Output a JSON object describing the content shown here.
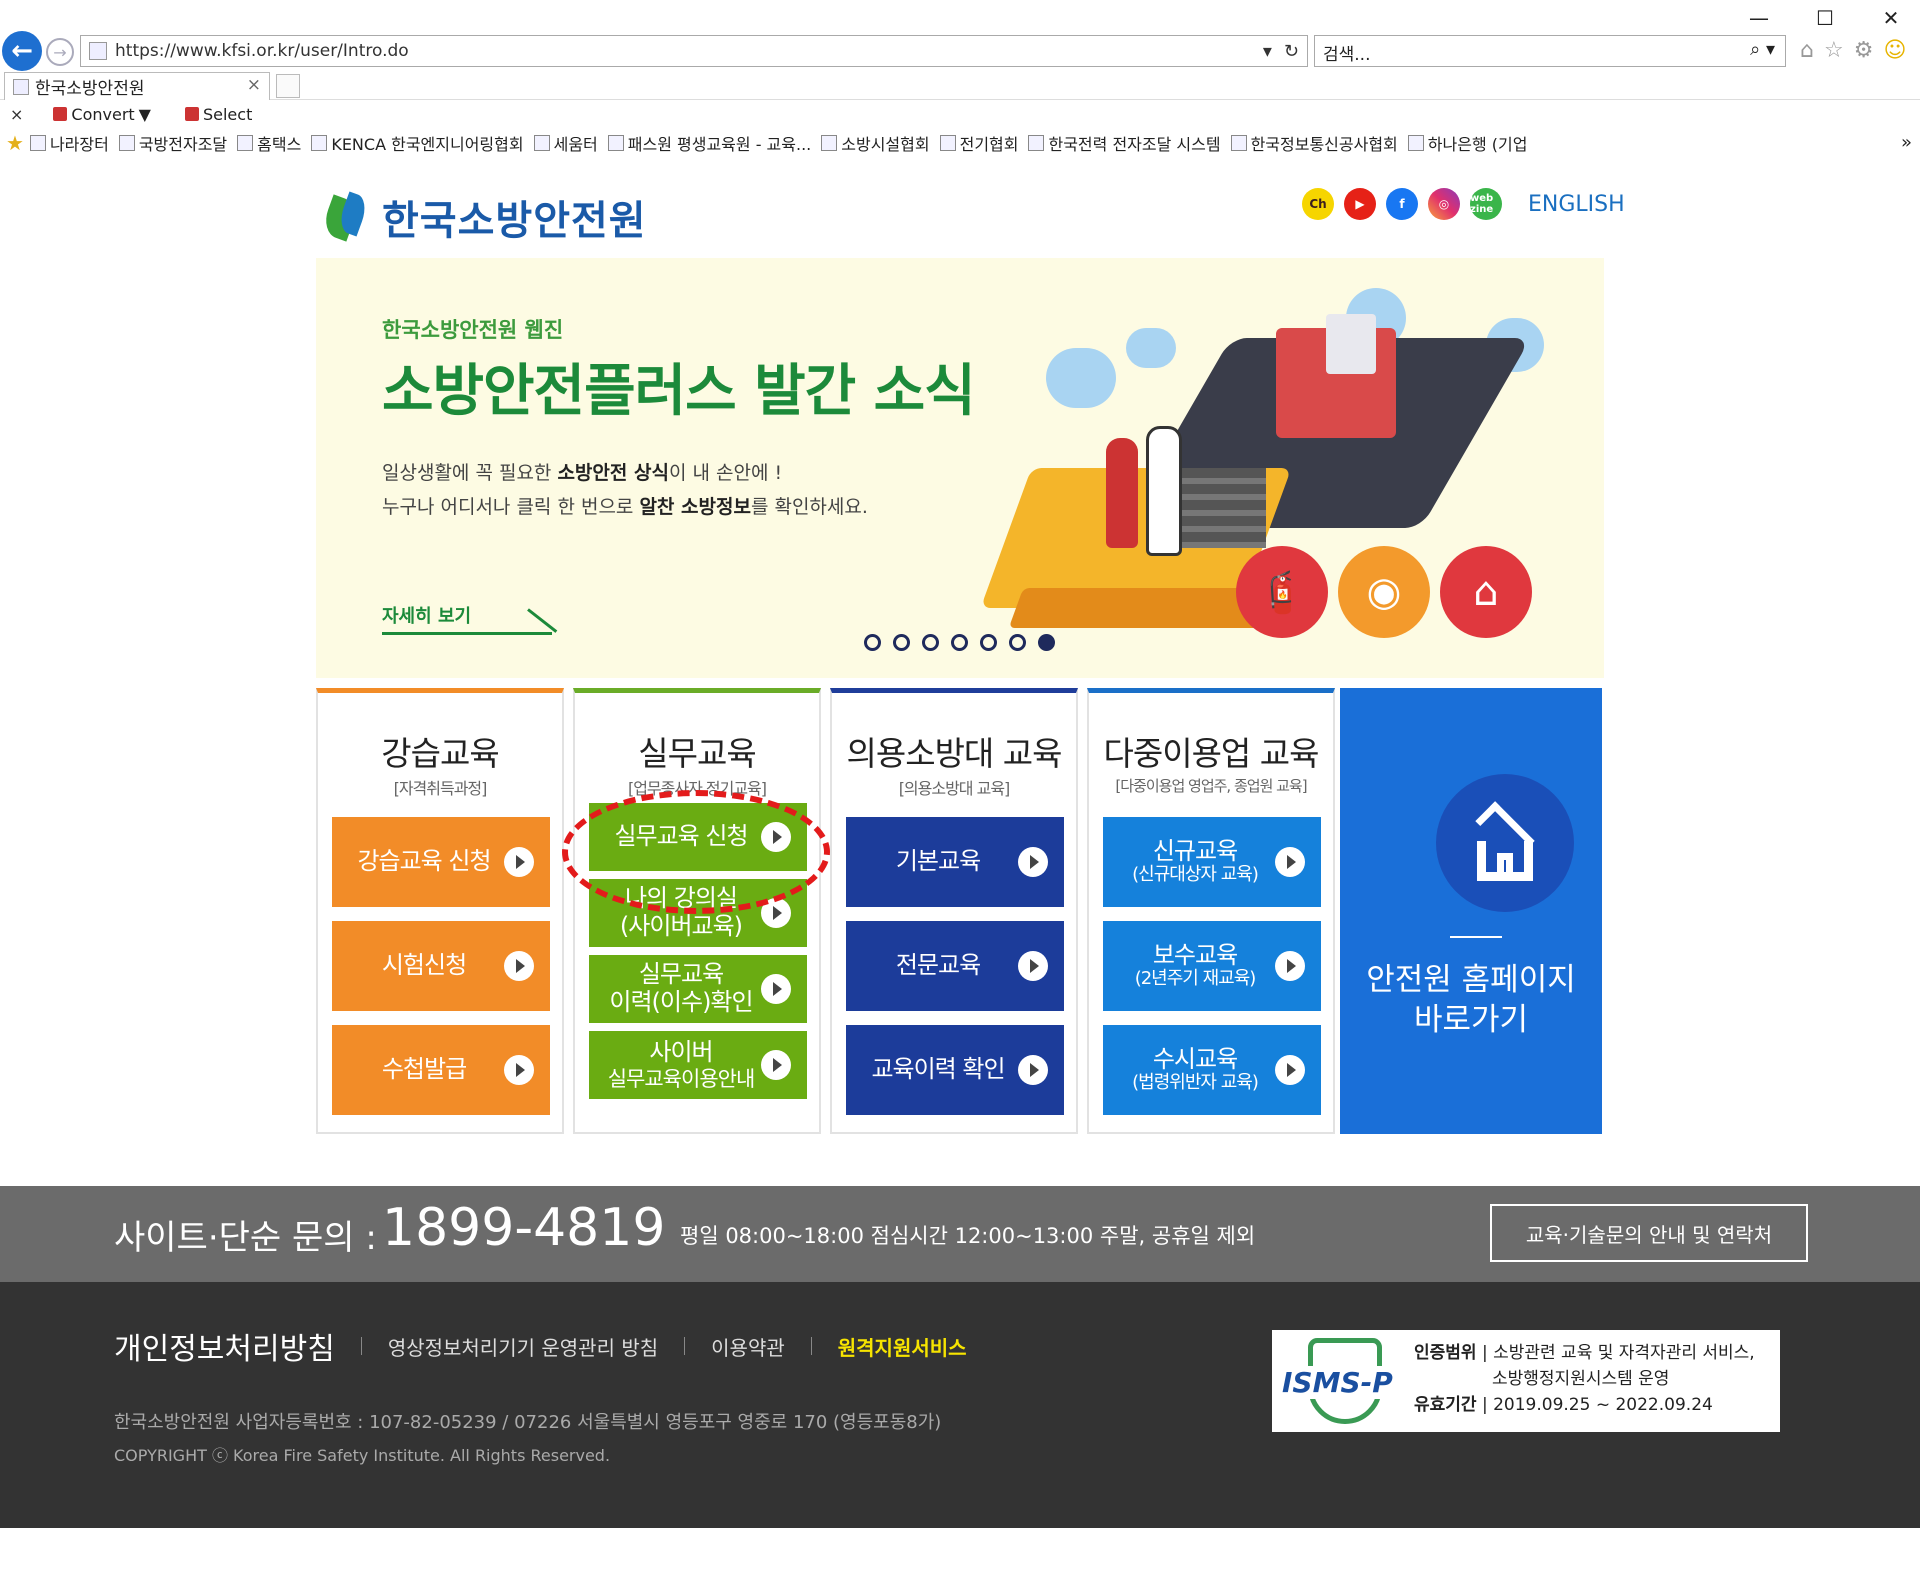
{
  "browser": {
    "url": "https://www.kfsi.or.kr/user/Intro.do",
    "search_placeholder": "검색...",
    "tab_title": "한국소방안전원",
    "cmd_convert": "Convert",
    "cmd_select": "Select",
    "bookmarks": [
      "나라장터",
      "국방전자조달",
      "홈택스",
      "KENCA 한국엔지니어링협회",
      "세움터",
      "패스원 평생교육원 - 교육...",
      "소방시설협회",
      "전기협회",
      "한국전력 전자조달 시스템",
      "한국정보통신공사협회",
      "하나은행 (기업"
    ]
  },
  "header": {
    "logo_text": "한국소방안전원",
    "social": [
      "Ch",
      "▶",
      "f",
      "◎",
      "web zine"
    ],
    "english": "ENGLISH"
  },
  "banner": {
    "subtitle": "한국소방안전원 웹진",
    "title": "소방안전플러스 발간 소식",
    "desc1_a": "일상생활에 꼭 필요한 ",
    "desc1_b": "소방안전 상식",
    "desc1_c": "이 내 손안에 !",
    "desc2_a": "누구나 어디서나 클릭 한 번으로 ",
    "desc2_b": "알찬 소방정보",
    "desc2_c": "를 확인하세요.",
    "more": "자세히 보기",
    "slide_count": 7,
    "active_slide": 7
  },
  "columns": [
    {
      "title": "강습교육",
      "subtitle": "[자격취득과정]",
      "buttons": [
        "강습교육 신청",
        "시험신청",
        "수첩발급"
      ]
    },
    {
      "title": "실무교육",
      "subtitle": "[업무종사자 정기교육]",
      "buttons": [
        {
          "l1": "실무교육 신청",
          "l2": ""
        },
        {
          "l1": "나의 강의실",
          "l2": "(사이버교육)"
        },
        {
          "l1": "실무교육",
          "l2": "이력(이수)확인"
        },
        {
          "l1": "사이버",
          "l2": "실무교육이용안내"
        }
      ]
    },
    {
      "title": "의용소방대 교육",
      "subtitle": "[의용소방대 교육]",
      "buttons": [
        "기본교육",
        "전문교육",
        "교육이력 확인"
      ]
    },
    {
      "title": "다중이용업 교육",
      "subtitle": "[다중이용업 영업주, 종업원 교육]",
      "buttons": [
        {
          "l1": "신규교육",
          "l2": "(신규대상자 교육)"
        },
        {
          "l1": "보수교육",
          "l2": "(2년주기 재교육)"
        },
        {
          "l1": "수시교육",
          "l2": "(법령위반자 교육)"
        }
      ]
    }
  ],
  "home_card": {
    "line1": "안전원 홈페이지",
    "line2": "바로가기"
  },
  "footer": {
    "label": "사이트·단순 문의 :",
    "tel": "1899-4819",
    "hours": "평일 08:00~18:00  점심시간 12:00~13:00  주말, 공휴일 제외",
    "contact_btn": "교육·기술문의 안내 및 연락처",
    "privacy": "개인정보처리방침",
    "cctv": "영상정보처리기기 운영관리 방침",
    "terms": "이용약관",
    "remote": "원격지원서비스",
    "address": "한국소방안전원 사업자등록번호 : 107-82-05239 / 07226 서울특별시 영등포구 영중로 170 (영등포동8가)",
    "copyright": "COPYRIGHT ⓒ Korea Fire Safety Institute. All Rights Reserved.",
    "isms_logo": "ISMS-P",
    "isms_l1_k": "인증범위",
    "isms_l1": " | 소방관련 교육 및 자격자관리 서비스,",
    "isms_l2": "소방행정지원시스템 운영",
    "isms_l3_k": "유효기간",
    "isms_l3": " | 2019.09.25 ~ 2022.09.24"
  },
  "colors": {
    "orange": "#f28c28",
    "green": "#6aac12",
    "navy": "#1c3c9a",
    "blue": "#1581db",
    "highlight": "#e31b1b"
  }
}
